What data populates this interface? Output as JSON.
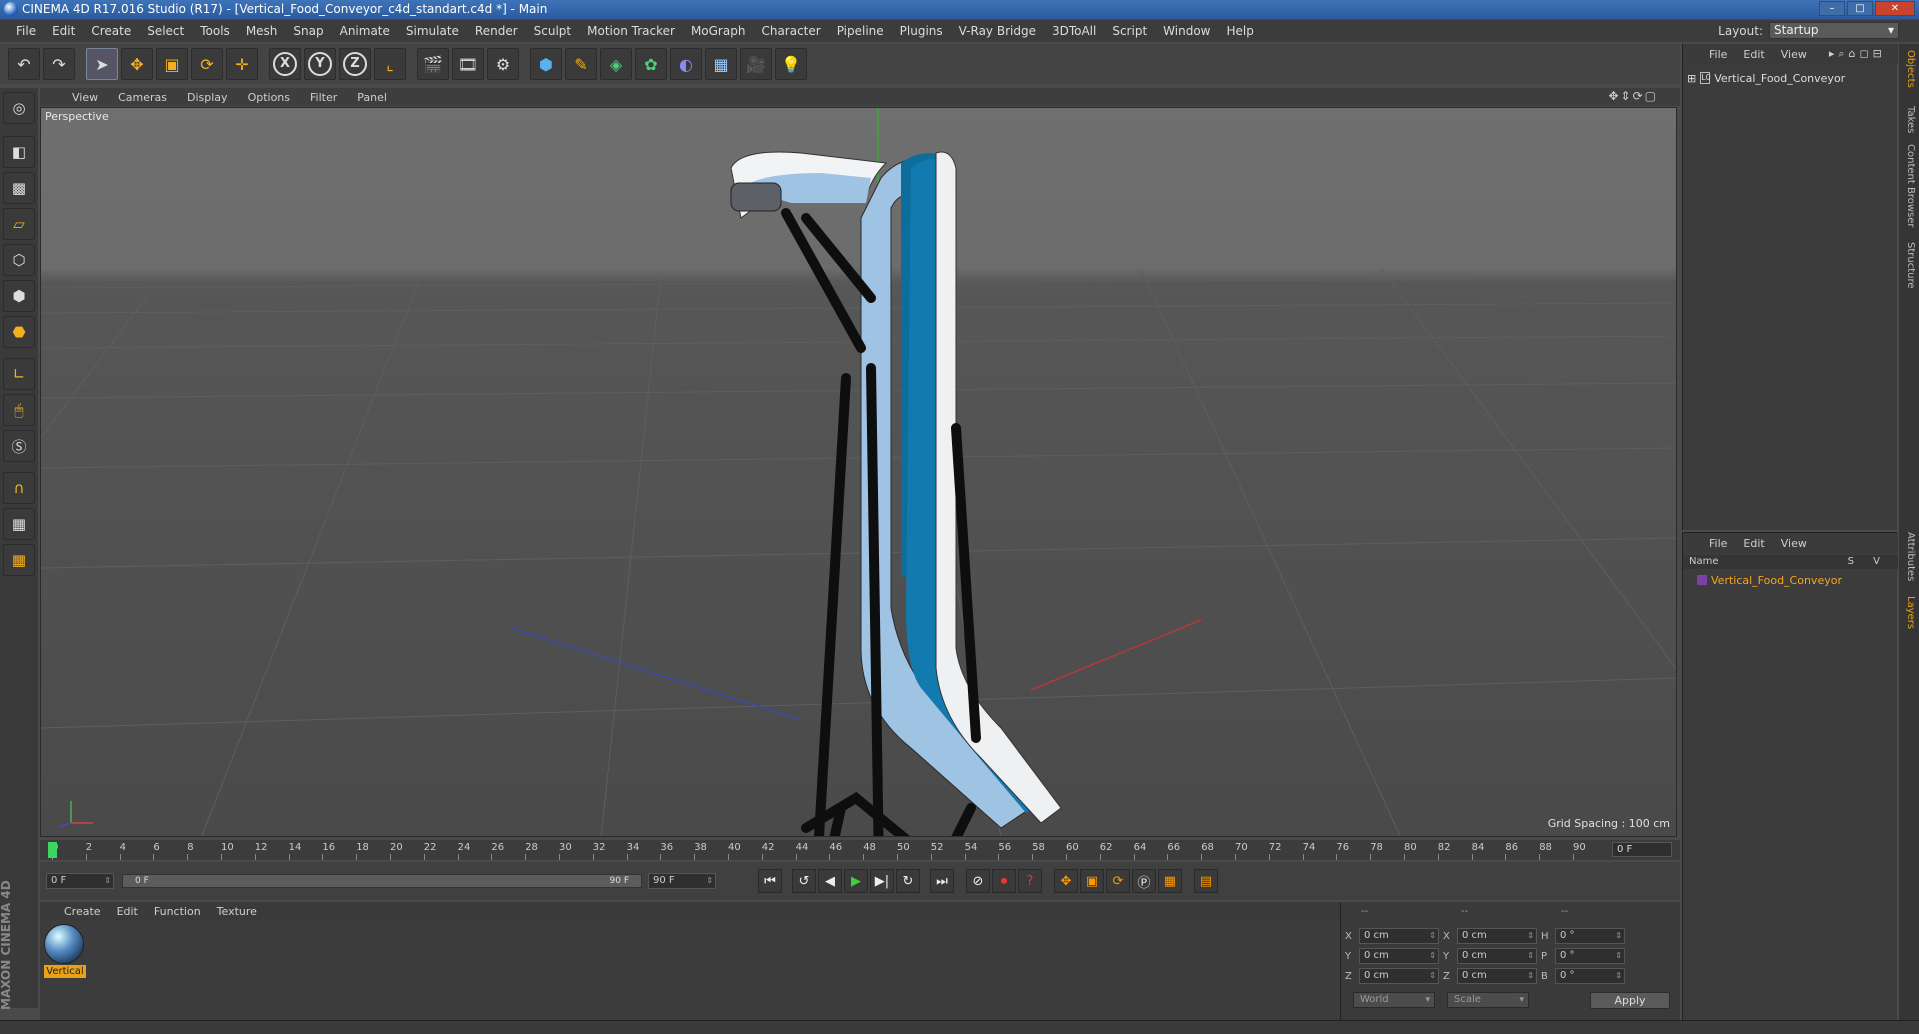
{
  "window": {
    "title": "CINEMA 4D R17.016 Studio (R17) - [Vertical_Food_Conveyor_c4d_standart.c4d *] - Main"
  },
  "menubar": [
    "File",
    "Edit",
    "Create",
    "Select",
    "Tools",
    "Mesh",
    "Snap",
    "Animate",
    "Simulate",
    "Render",
    "Sculpt",
    "Motion Tracker",
    "MoGraph",
    "Character",
    "Pipeline",
    "Plugins",
    "V-Ray Bridge",
    "3DToAll",
    "Script",
    "Window",
    "Help"
  ],
  "layout": {
    "label": "Layout:",
    "value": "Startup"
  },
  "viewport": {
    "menu": [
      "View",
      "Cameras",
      "Display",
      "Options",
      "Filter",
      "Panel"
    ],
    "label": "Perspective",
    "grid_spacing": "Grid Spacing : 100 cm"
  },
  "timeline": {
    "ticks": [
      "0",
      "2",
      "4",
      "6",
      "8",
      "10",
      "12",
      "14",
      "16",
      "18",
      "20",
      "22",
      "24",
      "26",
      "28",
      "30",
      "32",
      "34",
      "36",
      "38",
      "40",
      "42",
      "44",
      "46",
      "48",
      "50",
      "52",
      "54",
      "56",
      "58",
      "60",
      "62",
      "64",
      "66",
      "68",
      "70",
      "72",
      "74",
      "76",
      "78",
      "80",
      "82",
      "84",
      "86",
      "88",
      "90"
    ],
    "current_frame": "0 F",
    "start": "0 F",
    "range_start": "0 F",
    "range_end": "90 F",
    "end": "90 F"
  },
  "materials": {
    "menu": [
      "Create",
      "Edit",
      "Function",
      "Texture"
    ],
    "items": [
      {
        "label": "Vertical"
      }
    ]
  },
  "coords": {
    "headers": [
      "--",
      "--",
      "--"
    ],
    "rows": [
      {
        "axis": "X",
        "pos": "0 cm",
        "axis2": "X",
        "size": "0 cm",
        "axis3": "H",
        "rot": "0 °"
      },
      {
        "axis": "Y",
        "pos": "0 cm",
        "axis2": "Y",
        "size": "0 cm",
        "axis3": "P",
        "rot": "0 °"
      },
      {
        "axis": "Z",
        "pos": "0 cm",
        "axis2": "Z",
        "size": "0 cm",
        "axis3": "B",
        "rot": "0 °"
      }
    ],
    "world": "World",
    "scale": "Scale",
    "apply": "Apply"
  },
  "objects": {
    "menu": [
      "File",
      "Edit",
      "View"
    ],
    "items": [
      {
        "name": "Vertical_Food_Conveyor"
      }
    ]
  },
  "layers": {
    "menu": [
      "File",
      "Edit",
      "View"
    ],
    "col_name": "Name",
    "col_sv": "S V",
    "items": [
      {
        "name": "Vertical_Food_Conveyor",
        "color": "#7d3fa8"
      }
    ]
  },
  "right_tabs": [
    "Objects",
    "Takes",
    "Content Browser",
    "Structure",
    "Attributes",
    "Layers"
  ],
  "brand": "MAXON CINEMA 4D"
}
